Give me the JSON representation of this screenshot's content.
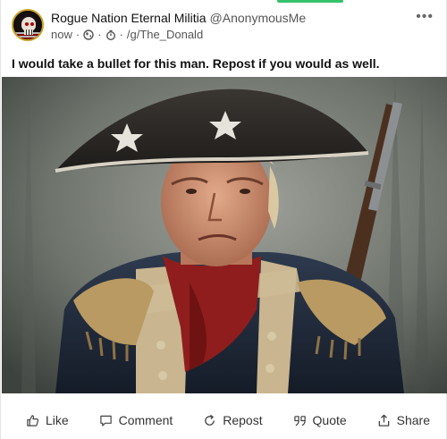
{
  "post": {
    "author_name": "Rogue Nation Eternal Militia",
    "author_handle": "@AnonymousMe",
    "timestamp": "now",
    "separator": "·",
    "community": "/g/The_Donald",
    "text": "I would take a bullet for this man. Repost if you would as well.",
    "more_label": "•••"
  },
  "actions": {
    "like": "Like",
    "comment": "Comment",
    "repost": "Repost",
    "quote": "Quote",
    "share": "Share"
  },
  "colors": {
    "accent": "#36c26b",
    "avatar_border": "#c9a227"
  },
  "icons": [
    "avatar-skull-icon",
    "globe-icon",
    "timer-icon",
    "more-icon",
    "thumbs-up-icon",
    "comment-icon",
    "repost-icon",
    "quote-icon",
    "share-icon"
  ]
}
